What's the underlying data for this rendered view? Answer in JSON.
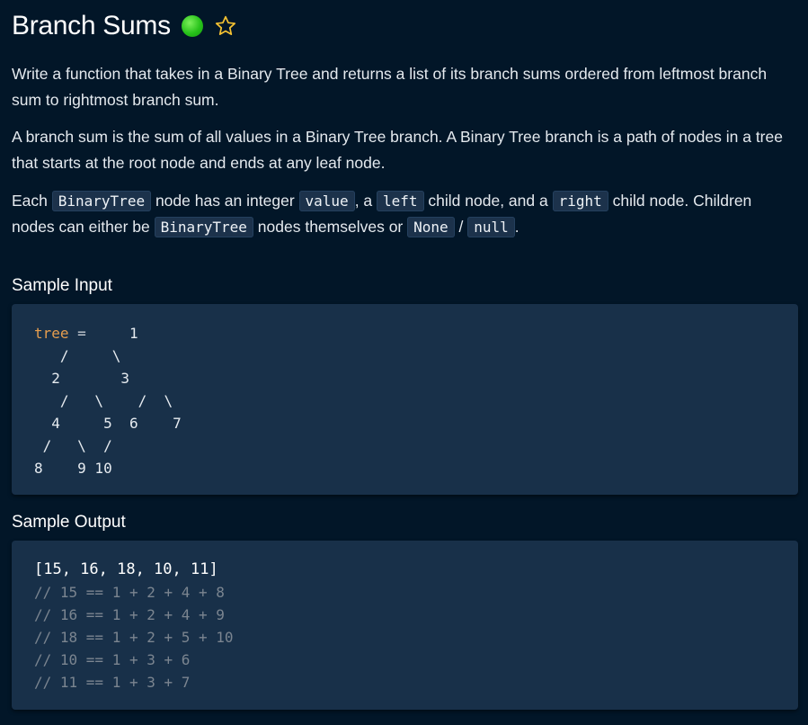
{
  "header": {
    "title": "Branch Sums",
    "status": "completed",
    "status_color": "#27c21a",
    "favorite_icon": "star-outline-icon",
    "favorite_color": "#f5c232"
  },
  "description": {
    "p1": "Write a function that takes in a Binary Tree and returns a list of its branch sums ordered from leftmost branch sum to rightmost branch sum.",
    "p2": "A branch sum is the sum of all values in a Binary Tree branch. A Binary Tree branch is a path of nodes in a tree that starts at the root node and ends at any leaf node.",
    "p3": {
      "t1": "Each ",
      "c1": "BinaryTree",
      "t2": " node has an integer ",
      "c2": "value",
      "t3": ", a ",
      "c3": "left",
      "t4": " child node, and a ",
      "c4": "right",
      "t5": " child node. Children nodes can either be ",
      "c5": "BinaryTree",
      "t6": " nodes themselves or ",
      "c6": "None",
      "t7": " / ",
      "c7": "null",
      "t8": "."
    }
  },
  "sample_input": {
    "heading": "Sample Input",
    "var_name": "tree",
    "operator": " =",
    "tree_lines": [
      "     1",
      "   /     \\",
      "  2       3",
      "   /   \\    /  \\",
      "  4     5  6    7",
      " /   \\  /",
      "8    9 10"
    ]
  },
  "sample_output": {
    "heading": "Sample Output",
    "result": "[15, 16, 18, 10, 11]",
    "comments": [
      "// 15 == 1 + 2 + 4 + 8",
      "// 16 == 1 + 2 + 4 + 9",
      "// 18 == 1 + 2 + 5 + 10",
      "// 10 == 1 + 3 + 6",
      "// 11 == 1 + 3 + 7"
    ]
  }
}
